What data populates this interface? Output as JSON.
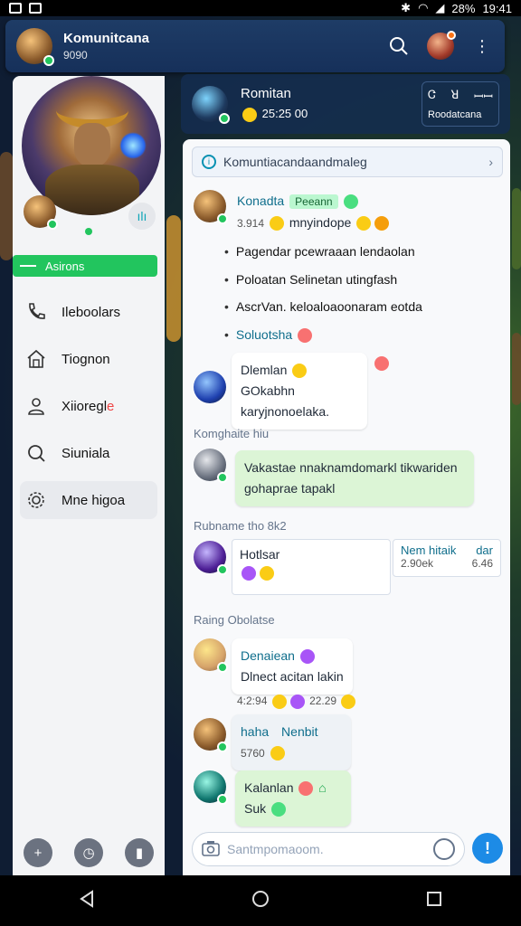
{
  "status_bar": {
    "battery": "28%",
    "time": "19:41"
  },
  "app_bar": {
    "title": "Komunitcana",
    "subtitle": "9090"
  },
  "drawer": {
    "action_label": "Asirons",
    "items": [
      {
        "label": "Ileboolars",
        "icon": "phone-icon"
      },
      {
        "label": "Tiognon",
        "icon": "house-icon"
      },
      {
        "label": "Xiioregl",
        "accent": "e",
        "icon": "person-icon"
      },
      {
        "label": "Siuniala",
        "icon": "search-icon"
      },
      {
        "label": "Mne higoa",
        "icon": "gear-icon"
      }
    ]
  },
  "chat_header": {
    "name": "Romitan",
    "status": "25:25 00",
    "box_line1_left": "Ꮳ",
    "box_line1_mid": "ꓤ",
    "box_line1_right": "ꟷꟷ",
    "box_line2": "Roodatcana"
  },
  "topic": {
    "text": "Komuntiacandaandmaleg"
  },
  "messages": {
    "m1": {
      "sender": "Konadta",
      "tag": "Peeann",
      "time": "3.914",
      "text": "mnyindope",
      "bullets": [
        "Pagendar pcewraaan lendaolan",
        "Poloatan Selinetan utingfash",
        "AscrVan. keloaloaoonaram eotda"
      ],
      "link": "Soluotsha"
    },
    "m2": {
      "line1": "Dlemlan",
      "line1b": "GOkabhn",
      "line2": "karyjnonoelaka."
    },
    "section1": "Komghaite hiu",
    "m3": {
      "line1": "Vakastae nnaknamdomarkl tikwariden",
      "line2": "gohaprae tapakl"
    },
    "section2": "Rubname tho 8k2",
    "m4": {
      "title": "Hotlsar",
      "card_title": "Nem hitaik",
      "card_sub": "2.90ek",
      "card_right": "dar",
      "card_time": "6.46"
    },
    "section3": "Raing Obolatse",
    "m5": {
      "sender": "Denaiean",
      "text": "Dlnect acitan lakin",
      "time": "4:2:94",
      "time2": "22.29"
    },
    "m6": {
      "sender": "haha",
      "sender2": "Nenbit",
      "time": "5760"
    },
    "m7": {
      "line1": "Kalanlan",
      "line2": "Suk"
    }
  },
  "composer": {
    "placeholder": "Santmpomaoom."
  },
  "colors": {
    "accent": "#22c55e",
    "primary": "#1d8be6",
    "header": "#1e3c66"
  }
}
